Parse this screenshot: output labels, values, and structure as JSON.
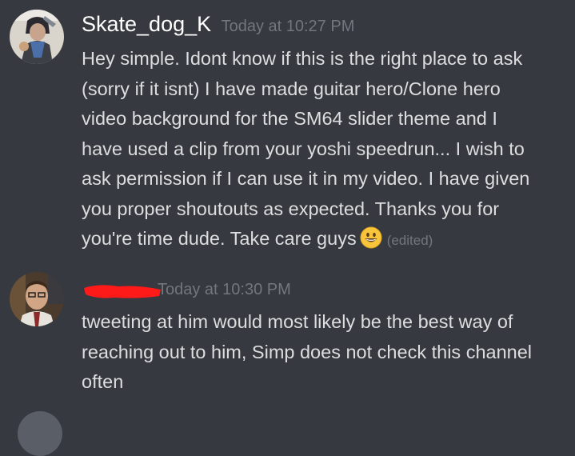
{
  "messages": [
    {
      "username": "Skate_dog_K",
      "timestamp": "Today at 10:27 PM",
      "lines": [
        "Hey simple. Idont know if this is the right place to ask",
        "(sorry if it isnt)  I have made guitar hero/Clone hero",
        "video background for the SM64 slider theme and I",
        "have used a clip from your yoshi speedrun... I wish to",
        "ask permission if I can use it in my video. I have given",
        "you proper shoutouts as expected. Thanks you for",
        "you're time dude. Take care guys"
      ],
      "emoji": "grinning-face-emoji",
      "edited_label": "(edited)"
    },
    {
      "username": "",
      "timestamp": "Today at 10:30 PM",
      "lines": [
        "tweeting at him would most likely be the best way of",
        "reaching out to him, Simp does not check this channel",
        "often"
      ]
    }
  ],
  "colors": {
    "background": "#36393f",
    "username": "#ffffff",
    "timestamp": "#72767d",
    "text": "#dcddde",
    "redaction": "#ff1a1a"
  }
}
